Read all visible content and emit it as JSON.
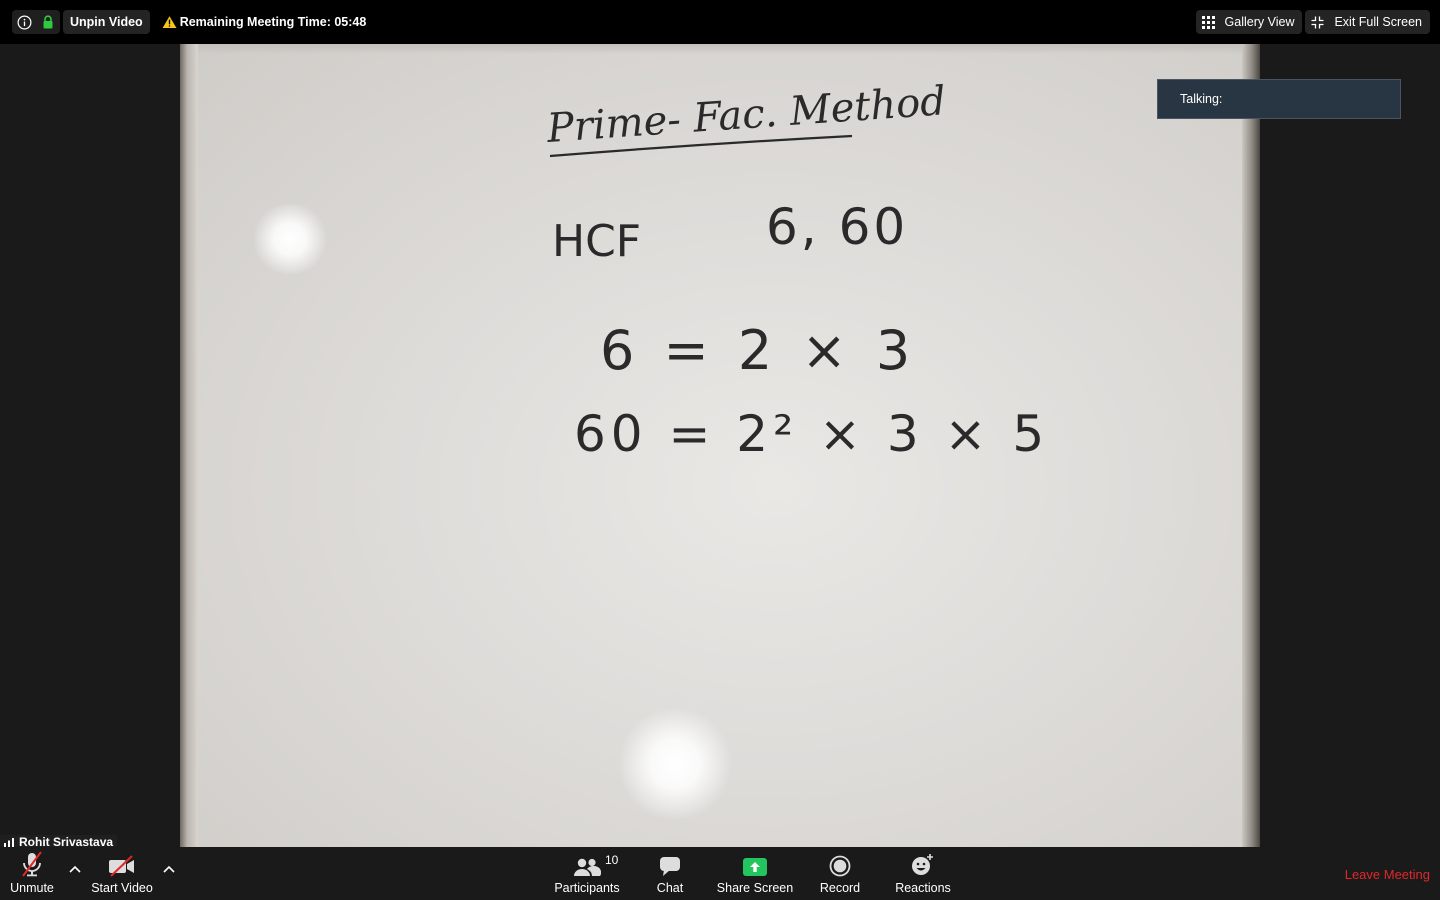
{
  "topbar": {
    "unpin_label": "Unpin Video",
    "timer_label": "Remaining Meeting Time: 05:48",
    "gallery_label": "Gallery View",
    "exit_fullscreen_label": "Exit Full Screen"
  },
  "board": {
    "title": "Prime- Fac. Method",
    "line1_left": "HCF",
    "line1_right": "6, 60",
    "line2": "6 = 2 × 3",
    "line3": "60 = 2² × 3 × 5"
  },
  "talking": {
    "label": "Talking:"
  },
  "speaker": {
    "name": "Rohit Srivastava"
  },
  "toolbar": {
    "unmute_label": "Unmute",
    "start_video_label": "Start Video",
    "participants_label": "Participants",
    "participants_count": "10",
    "chat_label": "Chat",
    "share_label": "Share Screen",
    "record_label": "Record",
    "reactions_label": "Reactions",
    "leave_label": "Leave Meeting"
  },
  "colors": {
    "share_green": "#22c55e",
    "leave_red": "#e02828",
    "lock_green": "#2ecc40",
    "warning_yellow": "#f5c518",
    "talking_bg": "#283542"
  }
}
